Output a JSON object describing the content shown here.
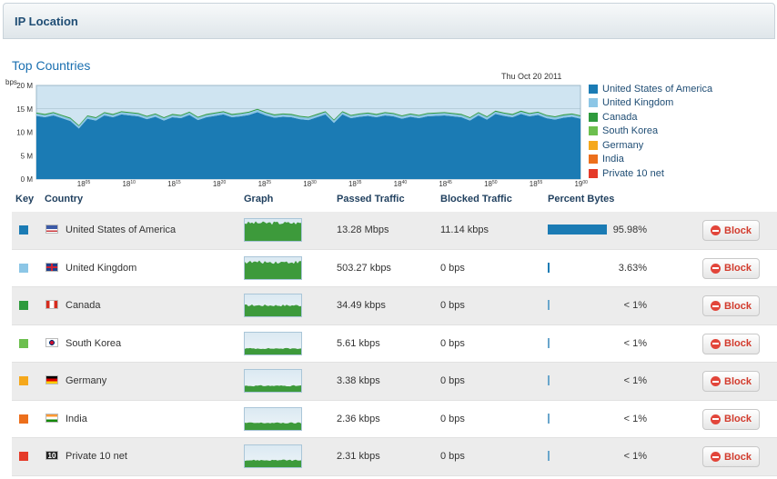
{
  "header": {
    "title": "IP Location"
  },
  "section": {
    "title": "Top Countries"
  },
  "colors": {
    "series": [
      "#1b7bb4",
      "#8cc6e6",
      "#2e9a3d",
      "#6cbf4e",
      "#f5a81c",
      "#ec6f1c",
      "#e53a28"
    ],
    "accent": "#1b7bb4",
    "block": "#d23b2d"
  },
  "chart_data": {
    "type": "area",
    "title": "",
    "date_label": "Thu Oct 20 2011",
    "y_unit": "bps",
    "y_ticks": [
      "0 M",
      "5 M",
      "10 M",
      "15 M",
      "20 M"
    ],
    "ylim": [
      0,
      20
    ],
    "x_ticks": [
      {
        "h": "18",
        "m": "05"
      },
      {
        "h": "18",
        "m": "10"
      },
      {
        "h": "18",
        "m": "15"
      },
      {
        "h": "18",
        "m": "20"
      },
      {
        "h": "18",
        "m": "25"
      },
      {
        "h": "18",
        "m": "30"
      },
      {
        "h": "18",
        "m": "35"
      },
      {
        "h": "18",
        "m": "40"
      },
      {
        "h": "18",
        "m": "45"
      },
      {
        "h": "18",
        "m": "50"
      },
      {
        "h": "18",
        "m": "55"
      },
      {
        "h": "19",
        "m": "00"
      }
    ],
    "series": [
      {
        "name": "United States of America",
        "values": [
          13.5,
          13.2,
          13.6,
          13.0,
          12.4,
          10.8,
          12.9,
          12.5,
          13.6,
          13.2,
          13.8,
          13.6,
          13.4,
          12.8,
          13.3,
          12.5,
          13.2,
          13.0,
          13.7,
          12.6,
          13.2,
          13.5,
          13.8,
          13.2,
          13.4,
          13.7,
          14.3,
          13.6,
          13.1,
          13.3,
          13.2,
          12.8,
          12.6,
          13.2,
          13.8,
          12.0,
          13.8,
          13.0,
          13.3,
          13.5,
          13.2,
          13.6,
          13.4,
          12.9,
          13.3,
          13.0,
          13.4,
          13.5,
          13.6,
          13.4,
          13.2,
          12.5,
          13.6,
          12.7,
          13.9,
          13.5,
          13.2,
          13.9,
          13.4,
          13.7,
          13.0,
          12.7,
          13.1,
          13.3,
          12.9
        ]
      },
      {
        "name": "United Kingdom",
        "values": [
          0.5,
          0.5,
          0.5,
          0.5,
          0.5,
          0.5,
          0.5,
          0.5,
          0.5,
          0.5,
          0.5,
          0.5,
          0.5,
          0.5,
          0.5,
          0.5,
          0.5,
          0.5,
          0.5,
          0.5,
          0.5,
          0.5,
          0.5,
          0.5,
          0.5,
          0.5,
          0.5,
          0.5,
          0.5,
          0.5,
          0.5,
          0.5,
          0.5,
          0.5,
          0.5,
          0.5,
          0.5,
          0.5,
          0.5,
          0.5,
          0.5,
          0.5,
          0.5,
          0.5,
          0.5,
          0.5,
          0.5,
          0.5,
          0.5,
          0.5,
          0.5,
          0.5,
          0.5,
          0.5,
          0.5,
          0.5,
          0.5,
          0.5,
          0.5,
          0.5,
          0.5,
          0.5,
          0.5,
          0.5,
          0.5
        ]
      },
      {
        "name": "Canada",
        "values": [
          0.2,
          0.2,
          0.2,
          0.2,
          0.2,
          0.2,
          0.2,
          0.2,
          0.2,
          0.2,
          0.2,
          0.2,
          0.2,
          0.2,
          0.2,
          0.2,
          0.2,
          0.2,
          0.2,
          0.2,
          0.2,
          0.2,
          0.2,
          0.2,
          0.2,
          0.2,
          0.2,
          0.2,
          0.2,
          0.2,
          0.2,
          0.2,
          0.2,
          0.2,
          0.2,
          0.2,
          0.2,
          0.2,
          0.2,
          0.2,
          0.2,
          0.2,
          0.2,
          0.2,
          0.2,
          0.2,
          0.2,
          0.2,
          0.2,
          0.2,
          0.2,
          0.2,
          0.2,
          0.2,
          0.2,
          0.2,
          0.2,
          0.2,
          0.2,
          0.2,
          0.2,
          0.2,
          0.2,
          0.2,
          0.2
        ]
      },
      {
        "name": "South Korea",
        "values": []
      },
      {
        "name": "Germany",
        "values": []
      },
      {
        "name": "India",
        "values": []
      },
      {
        "name": "Private 10 net",
        "values": []
      }
    ]
  },
  "table": {
    "headers": {
      "key": "Key",
      "country": "Country",
      "graph": "Graph",
      "passed": "Passed Traffic",
      "blocked": "Blocked Traffic",
      "percent": "Percent Bytes"
    },
    "block_label": "Block",
    "rows": [
      {
        "country": "United States of America",
        "flag": "us-flag-icon",
        "passed": "13.28 Mbps",
        "blocked": "11.14 kbps",
        "percent": "95.98%",
        "fraction": 0.9598
      },
      {
        "country": "United Kingdom",
        "flag": "uk-flag-icon",
        "passed": "503.27 kbps",
        "blocked": "0 bps",
        "percent": "3.63%",
        "fraction": 0.0363
      },
      {
        "country": "Canada",
        "flag": "canada-flag-icon",
        "passed": "34.49 kbps",
        "blocked": "0 bps",
        "percent": "< 1%",
        "fraction": 0.0025
      },
      {
        "country": "South Korea",
        "flag": "south-korea-flag-icon",
        "passed": "5.61 kbps",
        "blocked": "0 bps",
        "percent": "< 1%",
        "fraction": 0.0004
      },
      {
        "country": "Germany",
        "flag": "germany-flag-icon",
        "passed": "3.38 kbps",
        "blocked": "0 bps",
        "percent": "< 1%",
        "fraction": 0.0002
      },
      {
        "country": "India",
        "flag": "india-flag-icon",
        "passed": "2.36 kbps",
        "blocked": "0 bps",
        "percent": "< 1%",
        "fraction": 0.0002
      },
      {
        "country": "Private 10 net",
        "flag": "private-net-flag-icon",
        "flag_text": "10",
        "passed": "2.31 kbps",
        "blocked": "0 bps",
        "percent": "< 1%",
        "fraction": 0.0002
      }
    ]
  }
}
